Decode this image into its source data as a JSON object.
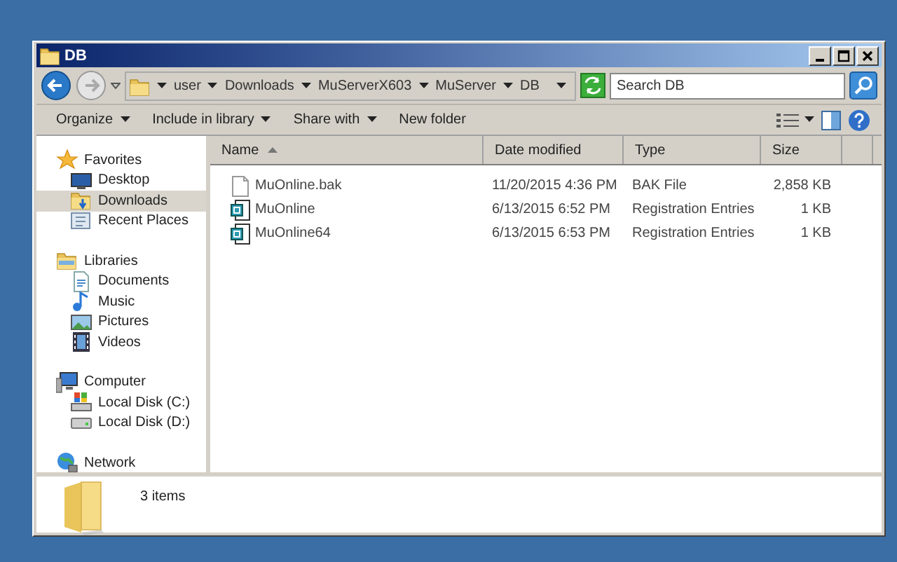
{
  "window": {
    "title": "DB"
  },
  "address_bar": {
    "segments": [
      "user",
      "Downloads",
      "MuServerX603",
      "MuServer",
      "DB"
    ]
  },
  "search": {
    "placeholder": "Search DB"
  },
  "toolbar": {
    "items": [
      {
        "label": "Organize",
        "dropdown": true
      },
      {
        "label": "Include in library",
        "dropdown": true
      },
      {
        "label": "Share with",
        "dropdown": true
      },
      {
        "label": "New folder",
        "dropdown": false
      }
    ]
  },
  "sidebar": {
    "groups": [
      {
        "label": "Favorites",
        "kind": "favorites",
        "selected": false,
        "children": [
          {
            "label": "Desktop",
            "kind": "desktop",
            "selected": false
          },
          {
            "label": "Downloads",
            "kind": "downloads",
            "selected": true
          },
          {
            "label": "Recent Places",
            "kind": "recent",
            "selected": false
          }
        ]
      },
      {
        "label": "Libraries",
        "kind": "libraries",
        "selected": false,
        "children": [
          {
            "label": "Documents",
            "kind": "documents",
            "selected": false
          },
          {
            "label": "Music",
            "kind": "music",
            "selected": false
          },
          {
            "label": "Pictures",
            "kind": "pictures",
            "selected": false
          },
          {
            "label": "Videos",
            "kind": "videos",
            "selected": false
          }
        ]
      },
      {
        "label": "Computer",
        "kind": "computer",
        "selected": false,
        "children": [
          {
            "label": "Local Disk (C:)",
            "kind": "system-disk",
            "selected": false
          },
          {
            "label": "Local Disk (D:)",
            "kind": "disk",
            "selected": false
          }
        ]
      },
      {
        "label": "Network",
        "kind": "network",
        "selected": false
      }
    ]
  },
  "table": {
    "columns": [
      "Name",
      "Date modified",
      "Type",
      "Size"
    ],
    "rows": [
      {
        "kind": "bak",
        "name": "MuOnline.bak",
        "date_modified": "11/20/2015 4:36 PM",
        "type": "BAK File",
        "size": "2,858 KB"
      },
      {
        "kind": "reg",
        "name": "MuOnline",
        "date_modified": "6/13/2015 6:52 PM",
        "type": "Registration Entries",
        "size": "1 KB"
      },
      {
        "kind": "reg",
        "name": "MuOnline64",
        "date_modified": "6/13/2015 6:53 PM",
        "type": "Registration Entries",
        "size": "1 KB"
      }
    ]
  },
  "status_bar": {
    "text": "3 items"
  }
}
